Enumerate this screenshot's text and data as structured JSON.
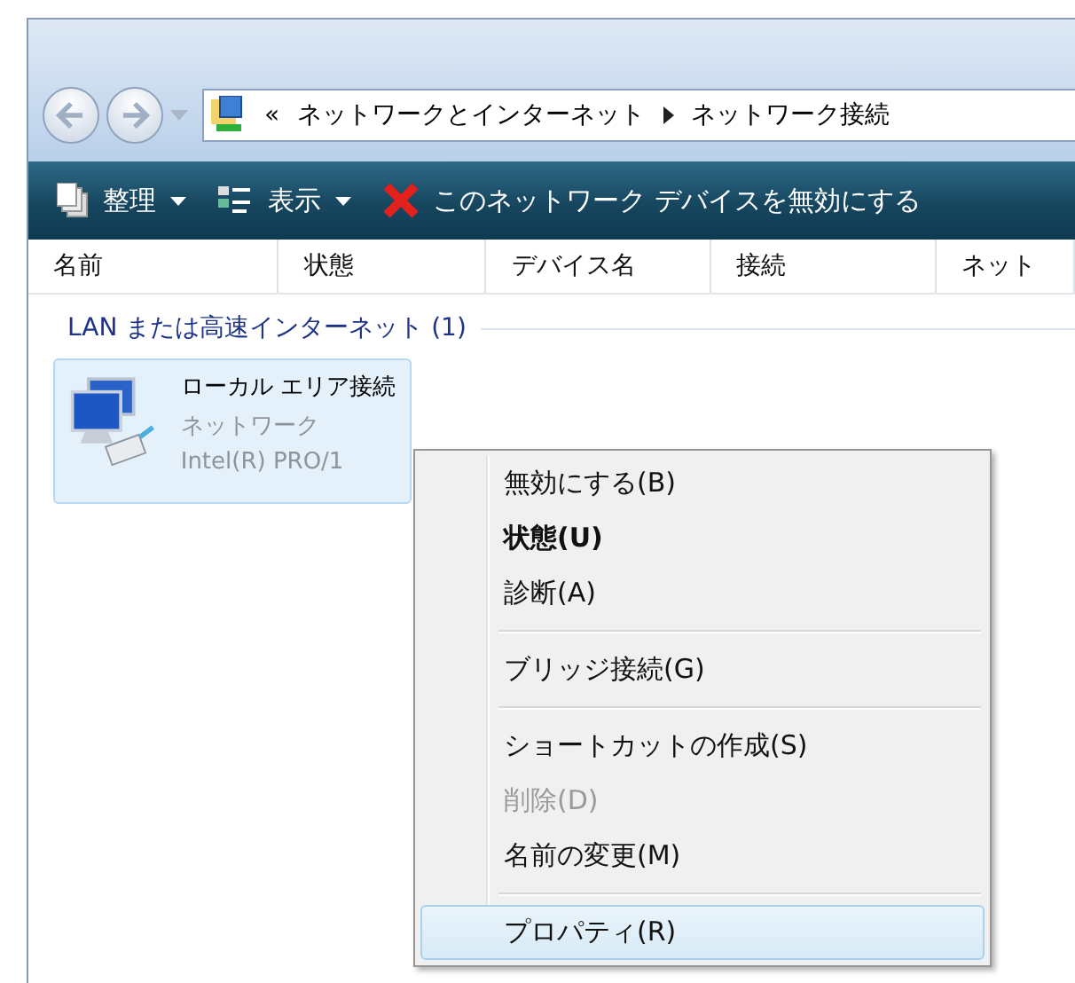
{
  "address_bar": {
    "overflow": "«",
    "path": [
      "ネットワークとインターネット",
      "ネットワーク接続"
    ]
  },
  "toolbar": [
    {
      "label": "整理",
      "kind": "menu"
    },
    {
      "label": "表示",
      "kind": "menu"
    },
    {
      "label": "このネットワーク デバイスを無効にする",
      "kind": "disable"
    }
  ],
  "columns": [
    "名前",
    "状態",
    "デバイス名",
    "接続",
    "ネット"
  ],
  "group": {
    "title": "LAN または高速インターネット (1)"
  },
  "connection": {
    "name": "ローカル エリア接続",
    "network": "ネットワーク",
    "device": "Intel(R) PRO/1",
    "selected": true
  },
  "context_menu": [
    [
      {
        "label": "無効にする(B)",
        "bold": false,
        "disabled": false,
        "selected": false
      },
      {
        "label": "状態(U)",
        "bold": true,
        "disabled": false,
        "selected": false
      },
      {
        "label": "診断(A)",
        "bold": false,
        "disabled": false,
        "selected": false
      }
    ],
    [
      {
        "label": "ブリッジ接続(G)",
        "bold": false,
        "disabled": false,
        "selected": false
      }
    ],
    [
      {
        "label": "ショートカットの作成(S)",
        "bold": false,
        "disabled": false,
        "selected": false
      },
      {
        "label": "削除(D)",
        "bold": false,
        "disabled": true,
        "selected": false
      },
      {
        "label": "名前の変更(M)",
        "bold": false,
        "disabled": false,
        "selected": false
      }
    ],
    [
      {
        "label": "プロパティ(R)",
        "bold": false,
        "disabled": false,
        "selected": true
      }
    ]
  ]
}
